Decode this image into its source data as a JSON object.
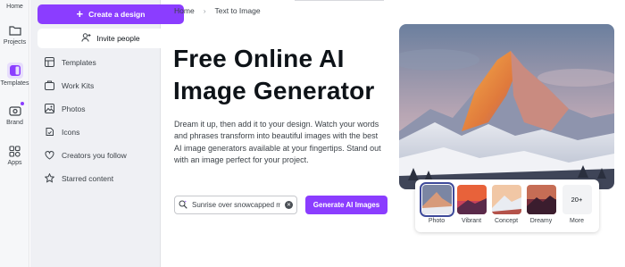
{
  "rail": {
    "items": [
      {
        "label": "Home",
        "icon": "home-icon"
      },
      {
        "label": "Projects",
        "icon": "folder-icon"
      },
      {
        "label": "Templates",
        "icon": "templates-icon",
        "active": true
      },
      {
        "label": "Brand",
        "icon": "brand-icon"
      },
      {
        "label": "Apps",
        "icon": "apps-icon"
      }
    ]
  },
  "panel": {
    "create_label": "Create a design",
    "invite_label": "Invite people",
    "nav": [
      {
        "label": "Templates",
        "icon": "templates-grid-icon"
      },
      {
        "label": "Work Kits",
        "icon": "work-kits-icon"
      },
      {
        "label": "Photos",
        "icon": "photos-icon"
      },
      {
        "label": "Icons",
        "icon": "icons-icon"
      },
      {
        "label": "Creators you follow",
        "icon": "creators-icon"
      },
      {
        "label": "Starred content",
        "icon": "star-icon"
      }
    ]
  },
  "breadcrumb": {
    "home": "Home",
    "current": "Text to Image"
  },
  "hero": {
    "title_line1": "Free Online AI",
    "title_line2": "Image Generator",
    "description": "Dream it up, then add it to your design. Watch your words and phrases transform into beautiful images with the best AI image generators available at your fingertips. Stand out with an image perfect for your project."
  },
  "prompt": {
    "value": "Sunrise over snowcapped mountains"
  },
  "generate_label": "Generate AI Images",
  "styles": [
    {
      "label": "Photo",
      "selected": true
    },
    {
      "label": "Vibrant"
    },
    {
      "label": "Concept"
    },
    {
      "label": "Dreamy"
    },
    {
      "label": "More",
      "count_text": "20+"
    }
  ],
  "colors": {
    "accent": "#8b3dff",
    "rail_bg": "#f6f7f9",
    "panel_bg": "#eff0f4"
  }
}
